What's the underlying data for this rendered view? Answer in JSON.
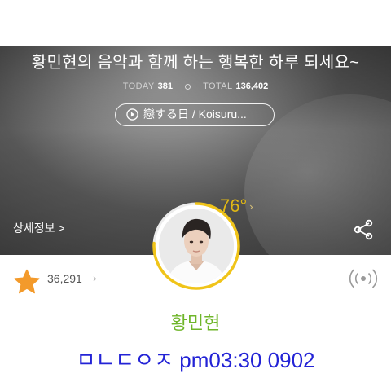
{
  "header": {
    "greeting": "황민현의 음악과 함께 하는 행복한 하루 되세요~",
    "today_label": "TODAY",
    "today_count": "381",
    "total_label": "TOTAL",
    "total_count": "136,402"
  },
  "now_playing": {
    "title": "戀する日 / Koisuru..."
  },
  "profile": {
    "detail_label": "상세정보 >",
    "temperature": "76°",
    "temperature_chevron": "›",
    "temperature_level": 0.76,
    "name": "황민현"
  },
  "favorites": {
    "count": "36,291",
    "chevron": "›"
  },
  "memo": {
    "text": "ㅁㄴㄷㅇㅈ pm03:30 0902"
  },
  "colors": {
    "accent_yellow": "#f0c419",
    "star_orange": "#f39a2b",
    "name_green": "#6fb62a",
    "memo_blue": "#2323d6"
  },
  "icons": [
    "play-icon",
    "share-icon",
    "star-icon",
    "radio-broadcast-icon"
  ]
}
